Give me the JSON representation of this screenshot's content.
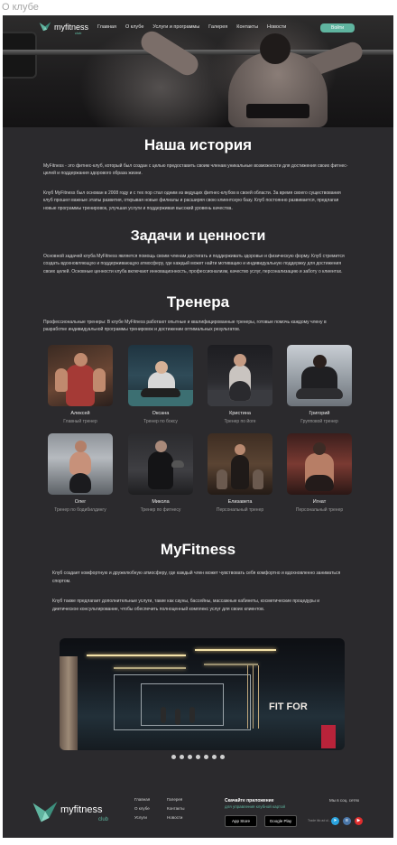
{
  "page_label": "О клубе",
  "header": {
    "logo_text": "myfitness",
    "logo_sub": "club",
    "nav": [
      "Главная",
      "О клубе",
      "Услуги и программы",
      "Галерея",
      "Контакты",
      "Новости"
    ],
    "login_label": "Войти"
  },
  "history": {
    "title": "Наша история",
    "p1": "MyFitness - это фитнес-клуб, который был создан с целью предоставить своим членам уникальные возможности для достижения своих фитнес-целей и поддержания здорового образа жизни.",
    "p2": "Клуб MyFitness был основан в 2008 году и с тех пор стал одним из ведущих фитнес-клубов в своей области. За время своего существования клуб прошел важные этапы развития, открывая новые филиалы и расширяя свою клиентскую базу. Клуб постоянно развивается, предлагая новые программы тренировок, улучшая услуги и поддерживая высокий уровень качества."
  },
  "values": {
    "title": "Задачи и ценности",
    "p1": "Основной задачей клуба MyFitness является помощь своим членам достигать и поддерживать здоровье и физическую форму. Клуб стремится создать вдохновляющую и поддерживающую атмосферу, где каждый может найти мотивацию и индивидуальную поддержку для достижения своих целей. Основные ценности клуба включают инновационность, профессионализм, качество услуг, персонализацию и заботу о клиентах."
  },
  "trainers": {
    "title": "Тренера",
    "intro": "Профессиональные тренеры: В клубе MyFitness работают опытные и квалифицированные тренеры, готовые помочь каждому члену в разработке индивидуальной программы тренировок и достижении оптимальных результатов.",
    "items": [
      {
        "name": "Алексей",
        "role": "Главный тренер"
      },
      {
        "name": "Оксана",
        "role": "Тренер по боксу"
      },
      {
        "name": "Кристина",
        "role": "Тренер по йоге"
      },
      {
        "name": "Григорий",
        "role": "Групповой тренер"
      },
      {
        "name": "Олег",
        "role": "Тренер по бодибилдингу"
      },
      {
        "name": "Микола",
        "role": "Тренер по фитнесу"
      },
      {
        "name": "Елизавета",
        "role": "Персональный тренер"
      },
      {
        "name": "Игнат",
        "role": "Персональный тренер"
      }
    ]
  },
  "about": {
    "title": "MyFitness",
    "p1": "Клуб создает комфортную и дружелюбную атмосферу, где каждый член может чувствовать себя комфортно и вдохновленно заниматься спортом.",
    "p2": "Клуб также предлагает дополнительные услуги, такие как сауны, бассейны, массажные кабинеты, косметические процедуры и диетическое консультирование, чтобы обеспечить полноценный комплекс услуг для своих клиентов.",
    "gallery_text": "FIT FOR"
  },
  "footer": {
    "logo_text": "myfitness",
    "logo_sub": "club",
    "col1": [
      "Главная",
      "О клубе",
      "Услуги"
    ],
    "col2": [
      "Галерея",
      "Контакты",
      "Новости"
    ],
    "app_title": "Скачайте приложение",
    "app_sub": "для управления клубной картой",
    "app_store": "App Store",
    "google_play": "Google Play",
    "social_title": "Мы в соц. сетях",
    "tagline": "Trade itlo ad ul..."
  },
  "colors": {
    "background": "#2b2a2d",
    "accent": "#5fb49f",
    "text": "#ffffff"
  }
}
